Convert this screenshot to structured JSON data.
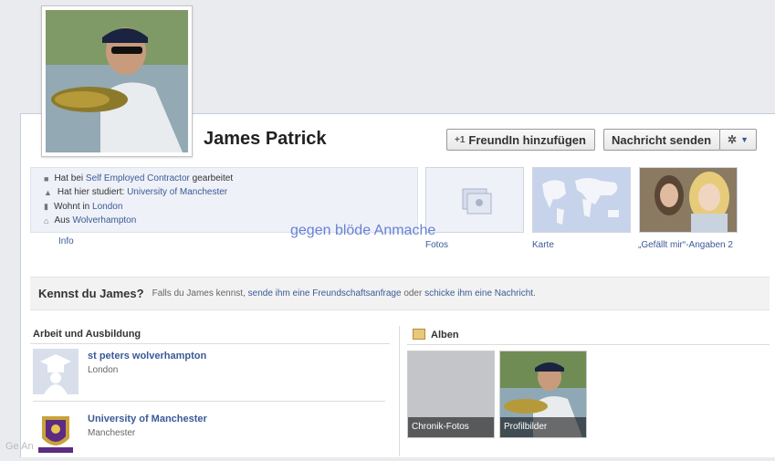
{
  "profile": {
    "name": "James Patrick"
  },
  "buttons": {
    "add_friend": "FreundIn hinzufügen",
    "send_message": "Nachricht senden"
  },
  "info": {
    "work_prefix": "Hat bei",
    "work_link": "Self Employed Contractor",
    "work_suffix": "gearbeitet",
    "study_prefix": "Hat hier studiert:",
    "study_link": "University of Manchester",
    "lives_prefix": "Wohnt in",
    "lives_link": "London",
    "from_prefix": "Aus",
    "from_link": "Wolverhampton",
    "tab_label": "Info"
  },
  "thumbs": {
    "photos": "Fotos",
    "map": "Karte",
    "likes": "„Gefällt mir“-Angaben 2"
  },
  "watermark": "gegen blöde Anmache",
  "kennst": {
    "title": "Kennst du James?",
    "text1": "Falls du James kennst,",
    "link1": "sende ihm eine Freundschaftsanfrage",
    "text2": "oder",
    "link2": "schicke ihm eine Nachricht",
    "text3": "."
  },
  "work_edu": {
    "heading": "Arbeit und Ausbildung",
    "items": [
      {
        "title": "st peters wolverhampton",
        "subtitle": "London"
      },
      {
        "title": "University of Manchester",
        "subtitle": "Manchester"
      }
    ]
  },
  "albums": {
    "heading": "Alben",
    "items": [
      {
        "label": "Chronik-Fotos"
      },
      {
        "label": "Profilbilder"
      }
    ]
  },
  "footer_mark": "Ge    An",
  "colors": {
    "link": "#3b5998",
    "watermark": "#4f6fcf",
    "panel_bg": "#eef1f7"
  }
}
